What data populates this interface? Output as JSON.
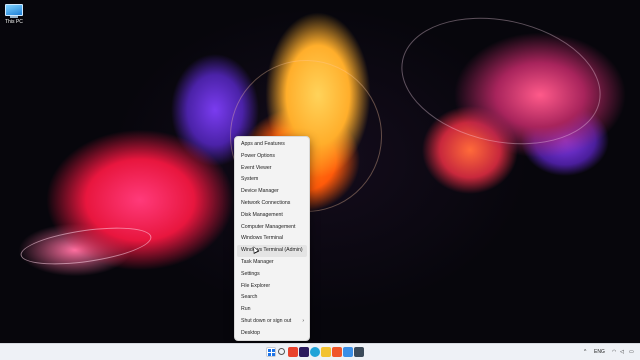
{
  "desktop": {
    "icons": [
      {
        "label": "This PC",
        "icon": "this-pc-icon"
      }
    ]
  },
  "context_menu": {
    "items": [
      {
        "label": "Apps and Features",
        "submenu": false
      },
      {
        "label": "Power Options",
        "submenu": false
      },
      {
        "label": "Event Viewer",
        "submenu": false
      },
      {
        "label": "System",
        "submenu": false
      },
      {
        "label": "Device Manager",
        "submenu": false
      },
      {
        "label": "Network Connections",
        "submenu": false
      },
      {
        "label": "Disk Management",
        "submenu": false
      },
      {
        "label": "Computer Management",
        "submenu": false
      },
      {
        "label": "Windows Terminal",
        "submenu": false
      },
      {
        "label": "Windows Terminal (Admin)",
        "submenu": false,
        "highlighted": true
      },
      {
        "label": "Task Manager",
        "submenu": false
      },
      {
        "label": "Settings",
        "submenu": false
      },
      {
        "label": "File Explorer",
        "submenu": false
      },
      {
        "label": "Search",
        "submenu": false
      },
      {
        "label": "Run",
        "submenu": false
      },
      {
        "label": "Shut down or sign out",
        "submenu": true,
        "arrow": "›"
      },
      {
        "label": "Desktop",
        "submenu": false
      }
    ]
  },
  "taskbar": {
    "pinned": [
      {
        "name": "start-icon",
        "color": "#1a73e8"
      },
      {
        "name": "search-icon",
        "color": "#5a5a5a"
      },
      {
        "name": "video-icon",
        "color": "#e8412c"
      },
      {
        "name": "premiere-icon",
        "color": "#2a1a5e"
      },
      {
        "name": "edge-icon",
        "color": "#1fa3d8"
      },
      {
        "name": "file-explorer-icon",
        "color": "#f2c231"
      },
      {
        "name": "brave-icon",
        "color": "#f0562a"
      },
      {
        "name": "photos-icon",
        "color": "#3a8ee6"
      },
      {
        "name": "terminal-icon",
        "color": "#3b4a5a"
      }
    ],
    "tray": [
      {
        "name": "chevron-up-icon",
        "glyph": "^"
      },
      {
        "name": "language-icon",
        "glyph": "ENG"
      },
      {
        "name": "wifi-icon",
        "glyph": "◠"
      },
      {
        "name": "volume-icon",
        "glyph": "◁"
      },
      {
        "name": "battery-icon",
        "glyph": "▭"
      }
    ]
  },
  "colors": {
    "menu_bg": "#f3f3f3",
    "taskbar_bg": "#eef1f6",
    "highlight": "#e4e4e4"
  }
}
